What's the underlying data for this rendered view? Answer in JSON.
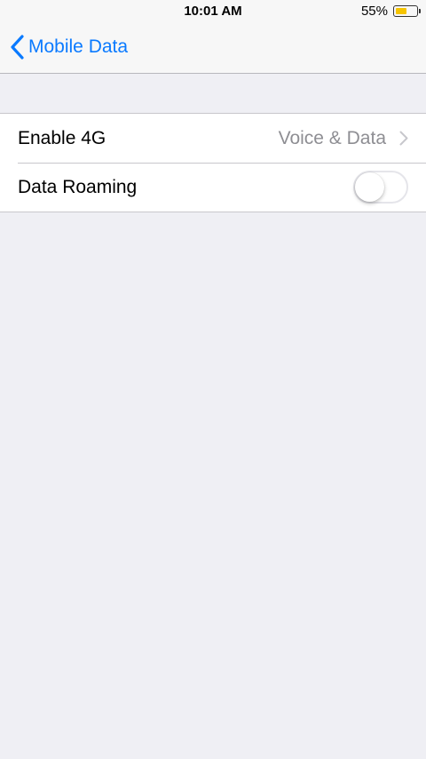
{
  "status_bar": {
    "time": "10:01 AM",
    "battery_percent": "55%",
    "battery_level": 0.55,
    "battery_color": "#f5c400"
  },
  "nav": {
    "back_label": "Mobile Data",
    "back_icon": "chevron-left-icon",
    "accent_color": "#0a7aff"
  },
  "settings": {
    "rows": [
      {
        "label": "Enable 4G",
        "value": "Voice & Data",
        "accessory": "chevron-right-icon"
      },
      {
        "label": "Data Roaming",
        "toggle_on": false
      }
    ]
  }
}
